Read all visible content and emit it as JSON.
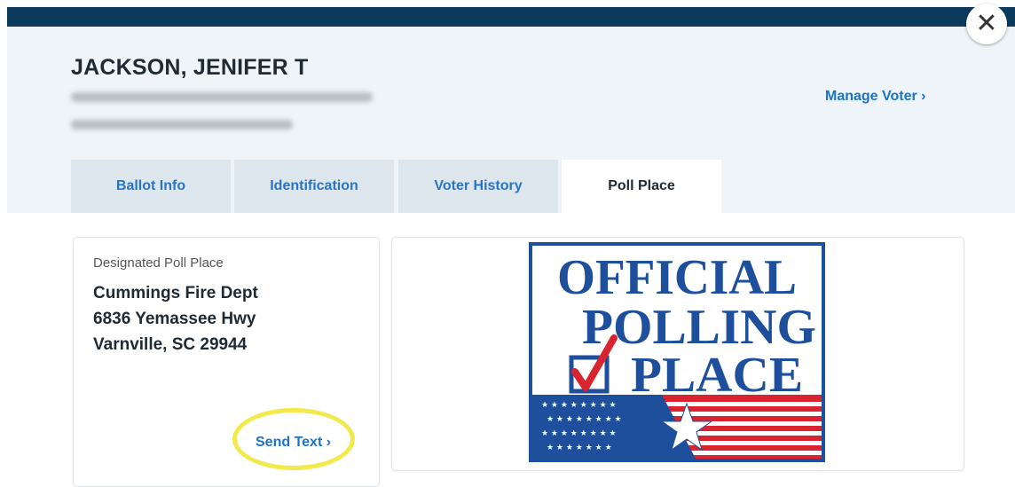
{
  "dialog": {
    "close_glyph": "✕"
  },
  "voter": {
    "name": "JACKSON, JENIFER T",
    "manage_label": "Manage Voter ›"
  },
  "tabs": [
    {
      "label": "Ballot Info",
      "active": false
    },
    {
      "label": "Identification",
      "active": false
    },
    {
      "label": "Voter History",
      "active": false
    },
    {
      "label": "Poll Place",
      "active": true
    }
  ],
  "poll_place": {
    "label": "Designated Poll Place",
    "name": "Cummings Fire Dept",
    "street": "6836 Yemassee Hwy",
    "city_state_zip": "Varnville, SC 29944",
    "send_text_label": "Send Text ›"
  },
  "sign": {
    "line1": "OFFICIAL",
    "line2": "POLLING",
    "line3": "PLACE"
  },
  "colors": {
    "top_bar": "#0b3a5c",
    "header_bg": "#eef4f8",
    "link_blue": "#1a73c7",
    "highlight_ring": "#f2ea4c",
    "sign_blue": "#1d4f9c",
    "sign_red": "#d9242f"
  }
}
